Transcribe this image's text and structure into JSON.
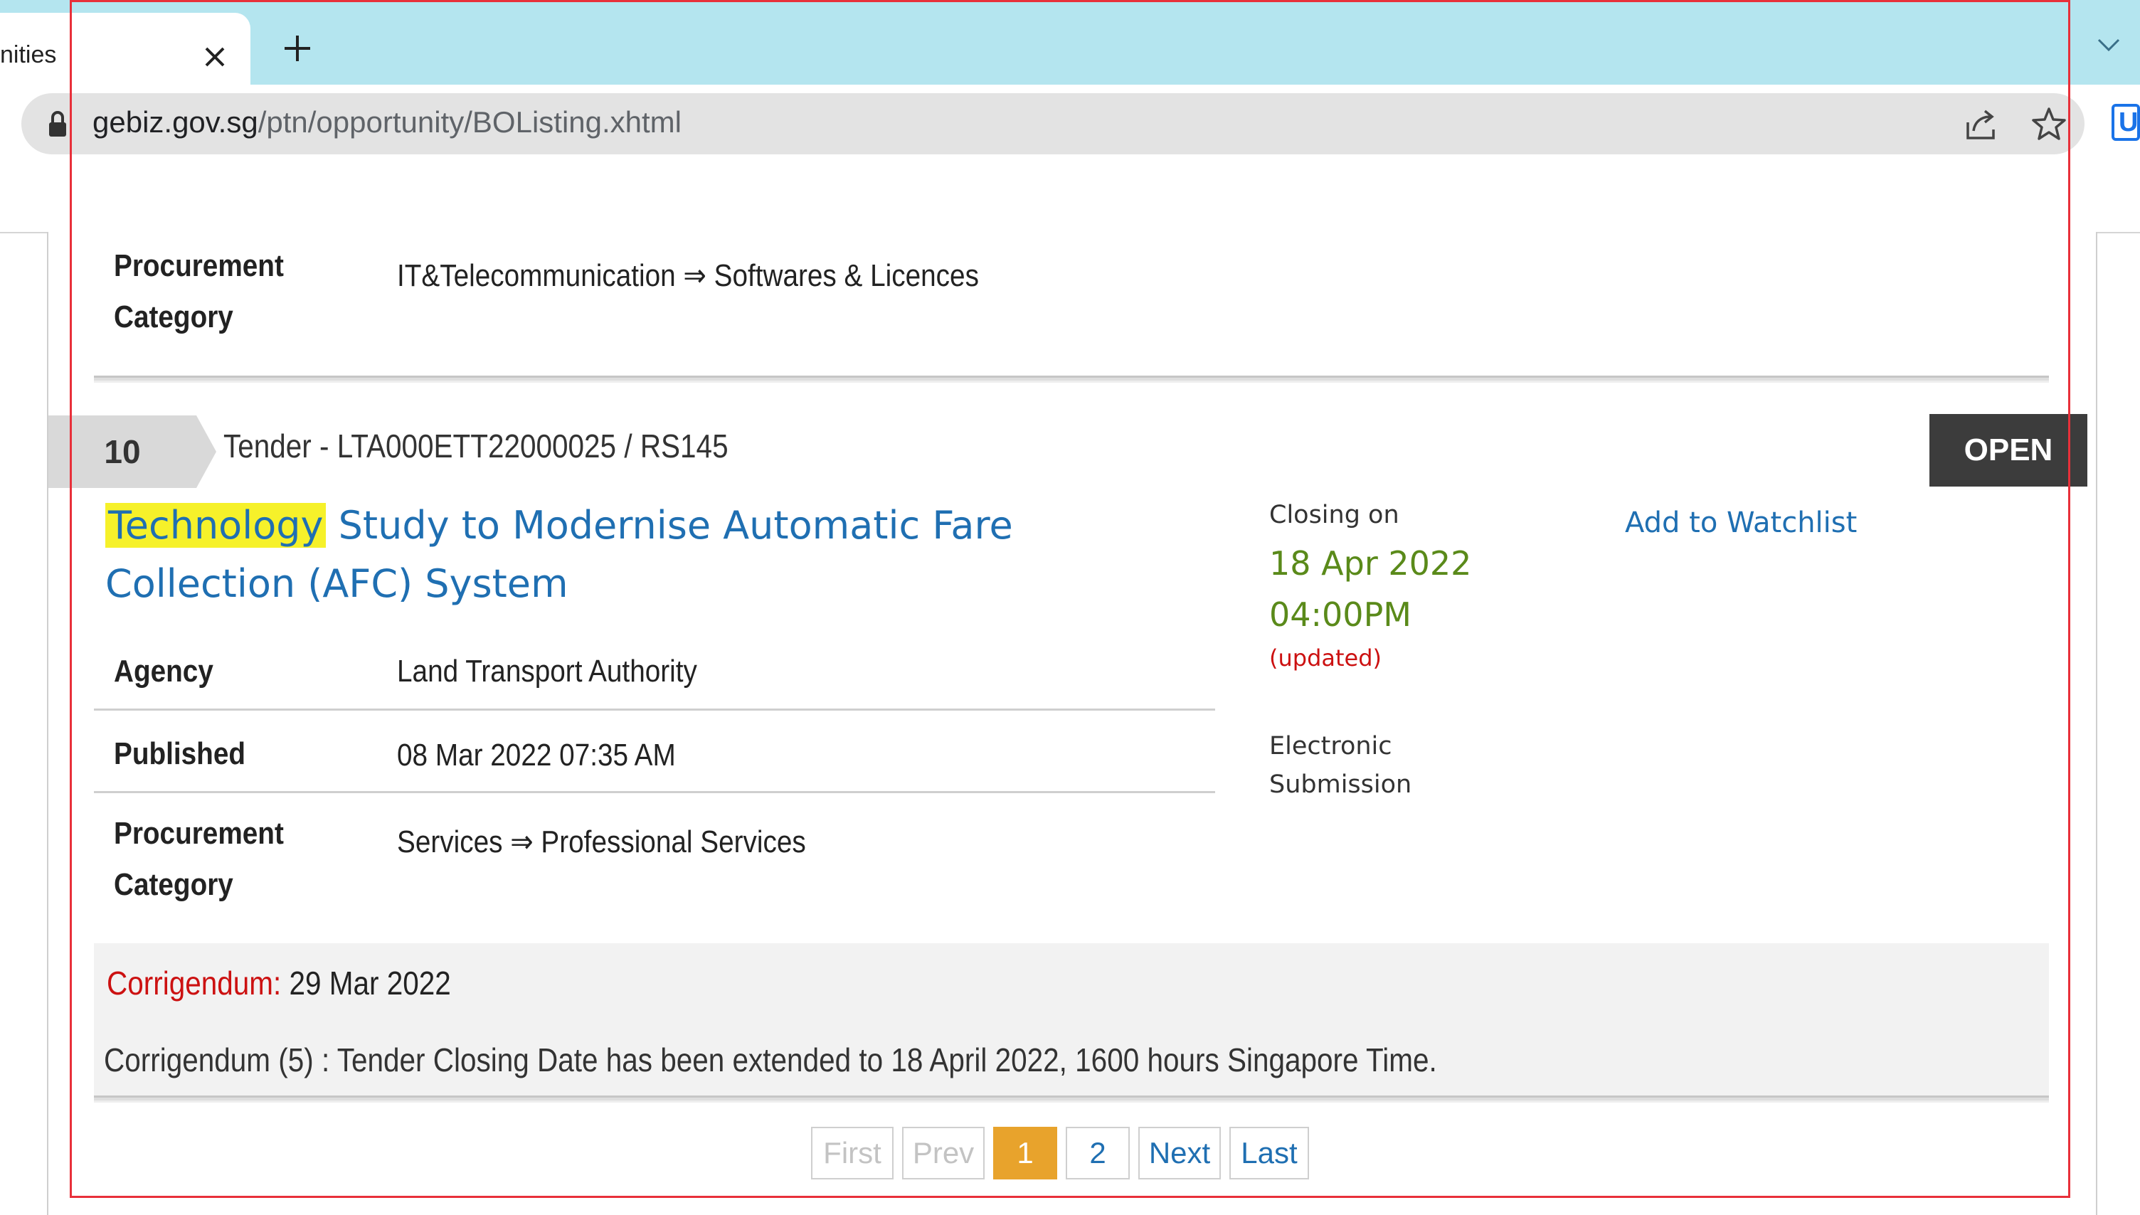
{
  "browser": {
    "tab_title": "nities",
    "url_domain": "gebiz.gov.sg",
    "url_path": "/ptn/opportunity/BOListing.xhtml",
    "extension_label": "U"
  },
  "previous_item": {
    "category_label": "Procurement Category",
    "category_value": "IT&Telecommunication ⇒ Softwares & Licences"
  },
  "listing": {
    "number": "10",
    "reference": "Tender - LTA000ETT22000025 / RS145",
    "status": "OPEN",
    "title_highlight": "Technology",
    "title_rest": " Study to Modernise Automatic Fare Collection (AFC) System",
    "closing_label": "Closing on",
    "closing_date": "18 Apr 2022",
    "closing_time": "04:00PM",
    "closing_note": "(updated)",
    "watchlist_label": "Add to Watchlist",
    "submission": "Electronic Submission",
    "agency_label": "Agency",
    "agency_value": "Land Transport Authority",
    "published_label": "Published",
    "published_value": "08 Mar 2022 07:35 AM",
    "category_label": "Procurement Category",
    "category_value": "Services ⇒ Professional Services",
    "corrigendum_label": "Corrigendum:",
    "corrigendum_date": "29 Mar 2022",
    "corrigendum_text": "Corrigendum (5) : Tender Closing Date has been extended to 18 April 2022, 1600 hours Singapore Time."
  },
  "pagination": {
    "first": "First",
    "prev": "Prev",
    "page1": "1",
    "page2": "2",
    "next": "Next",
    "last": "Last",
    "current_page": 1
  }
}
